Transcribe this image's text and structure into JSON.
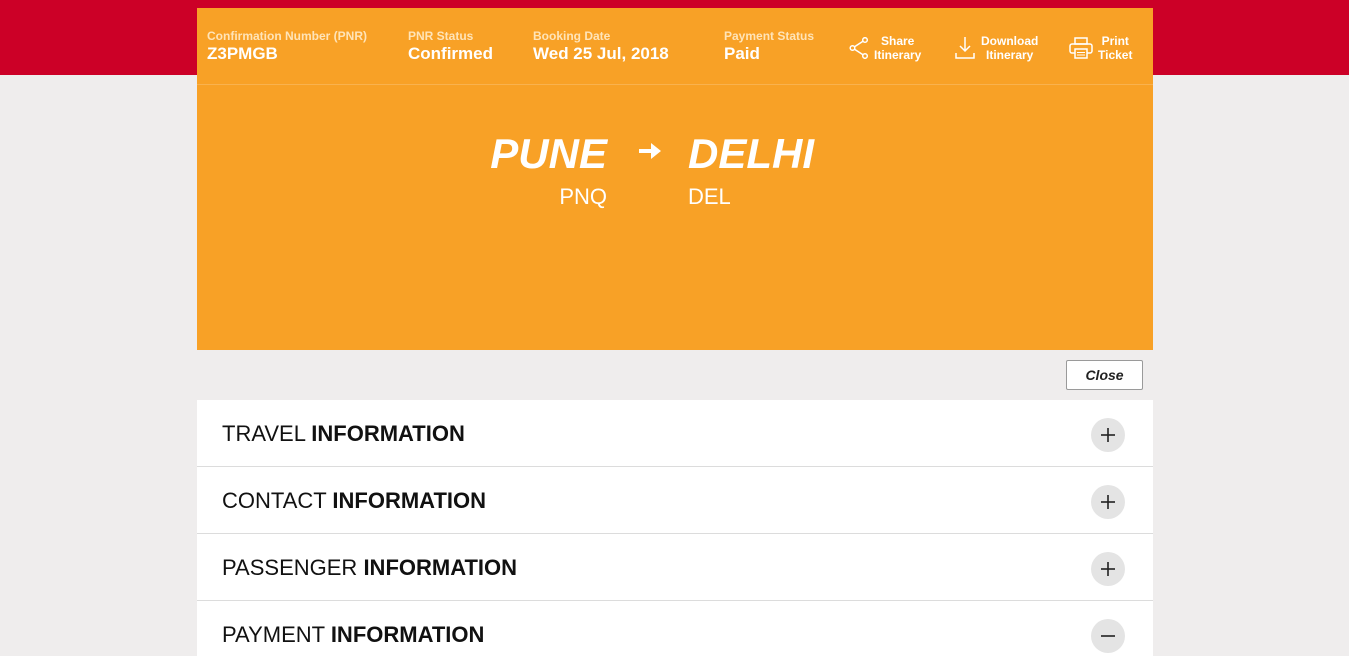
{
  "header": {
    "pnr": {
      "label": "Confirmation Number (PNR)",
      "value": "Z3PMGB"
    },
    "status": {
      "label": "PNR Status",
      "value": "Confirmed"
    },
    "booking_date": {
      "label": "Booking Date",
      "value": "Wed 25 Jul, 2018"
    },
    "payment": {
      "label": "Payment Status",
      "value": "Paid"
    },
    "actions": {
      "share": {
        "line1": "Share",
        "line2": "Itinerary",
        "icon": "share-icon"
      },
      "download": {
        "line1": "Download",
        "line2": "Itinerary",
        "icon": "download-icon"
      },
      "print": {
        "line1": "Print",
        "line2": "Ticket",
        "icon": "printer-icon"
      }
    }
  },
  "route": {
    "from_city": "PUNE",
    "from_code": "PNQ",
    "to_city": "DELHI",
    "to_code": "DEL",
    "arrow_icon": "arrow-right-icon"
  },
  "close_label": "Close",
  "sections": [
    {
      "light": "TRAVEL",
      "bold": "INFORMATION",
      "state": "collapsed",
      "icon": "plus-icon"
    },
    {
      "light": "CONTACT",
      "bold": "INFORMATION",
      "state": "collapsed",
      "icon": "plus-icon"
    },
    {
      "light": "PASSENGER",
      "bold": "INFORMATION",
      "state": "collapsed",
      "icon": "plus-icon"
    },
    {
      "light": "PAYMENT",
      "bold": "INFORMATION",
      "state": "expanded",
      "icon": "minus-icon"
    }
  ],
  "colors": {
    "brand_red": "#cc0027",
    "accent_orange": "#f8a126",
    "page_bg": "#efeded"
  }
}
